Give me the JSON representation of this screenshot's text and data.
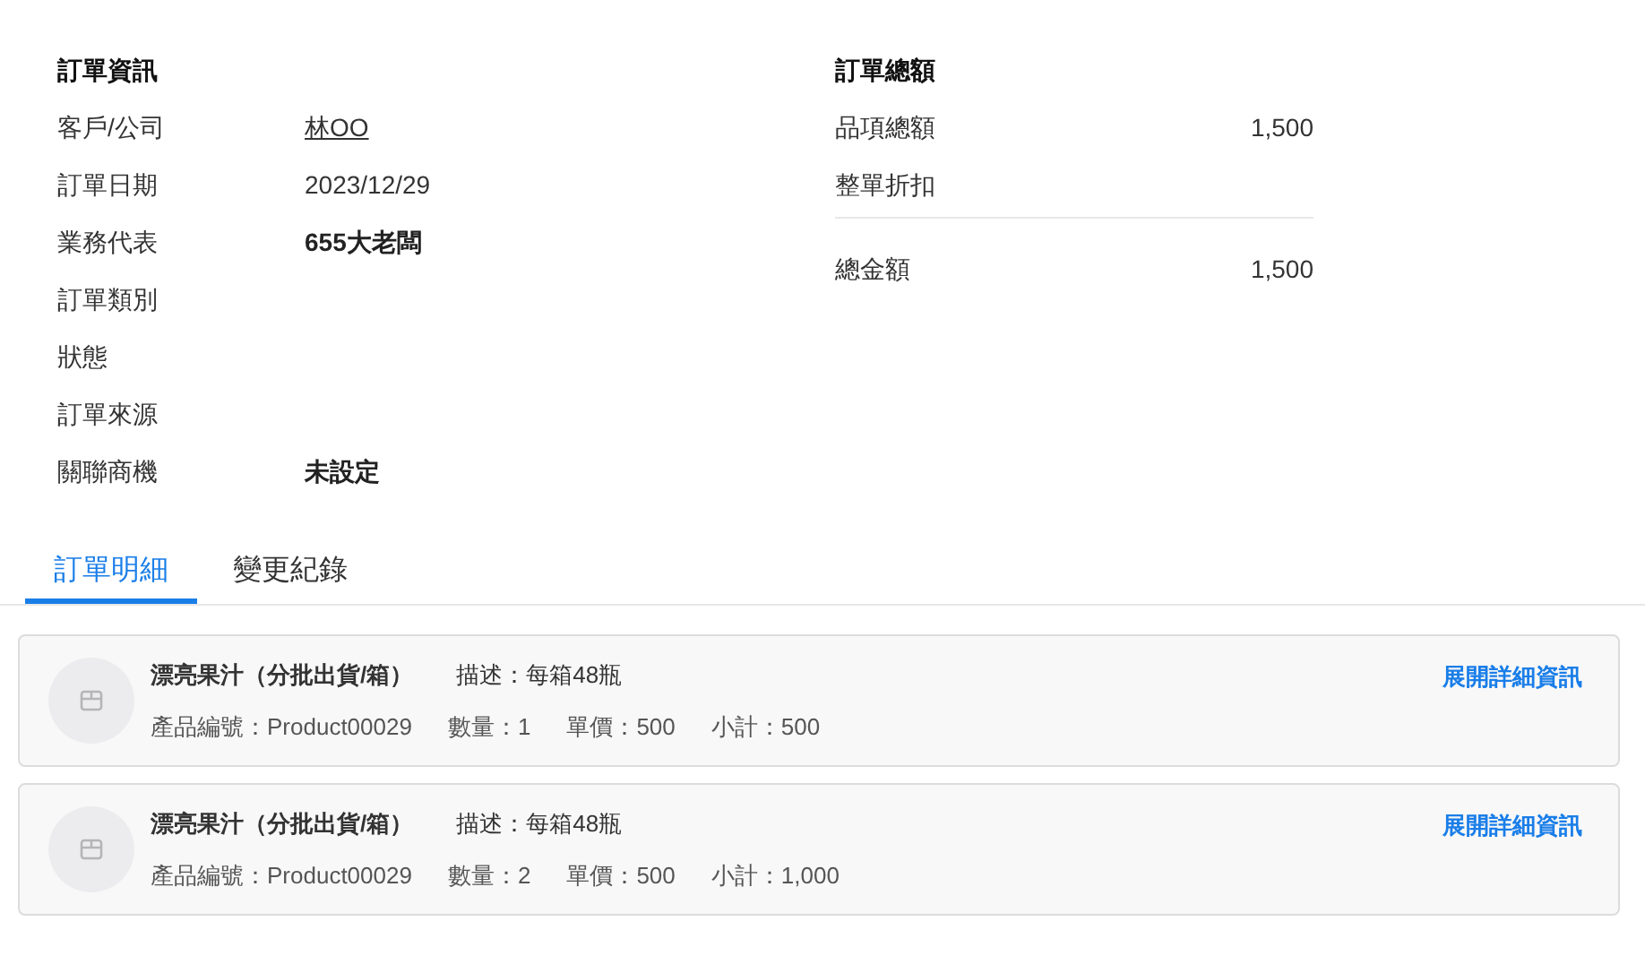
{
  "order_info": {
    "title": "訂單資訊",
    "rows": [
      {
        "label": "客戶/公司",
        "value": "林OO",
        "kind": "link"
      },
      {
        "label": "訂單日期",
        "value": "2023/12/29",
        "kind": "plain"
      },
      {
        "label": "業務代表",
        "value": "655大老闆",
        "kind": "strong"
      },
      {
        "label": "訂單類別"
      },
      {
        "label": "狀態"
      },
      {
        "label": "訂單來源"
      },
      {
        "label": "關聯商機",
        "value": "未設定",
        "kind": "strong"
      }
    ]
  },
  "order_total": {
    "title": "訂單總額",
    "rows": [
      {
        "label": "品項總額",
        "value": "1,500"
      },
      {
        "label": "整單折扣"
      }
    ],
    "total": {
      "label": "總金額",
      "value": "1,500"
    }
  },
  "tabs": [
    {
      "label": "訂單明細",
      "selected": true
    },
    {
      "label": "變更紀錄",
      "selected": false
    }
  ],
  "items": [
    {
      "name": "漂亮果汁（分批出貨/箱）",
      "description": "描述：每箱48瓶",
      "fields": [
        "產品編號：Product00029",
        "數量：1",
        "單價：500",
        "小計：500"
      ],
      "action": "展開詳細資訊"
    },
    {
      "name": "漂亮果汁（分批出貨/箱）",
      "description": "描述：每箱48瓶",
      "fields": [
        "產品編號：Product00029",
        "數量：2",
        "單價：500",
        "小計：1,000"
      ],
      "action": "展開詳細資訊"
    }
  ]
}
